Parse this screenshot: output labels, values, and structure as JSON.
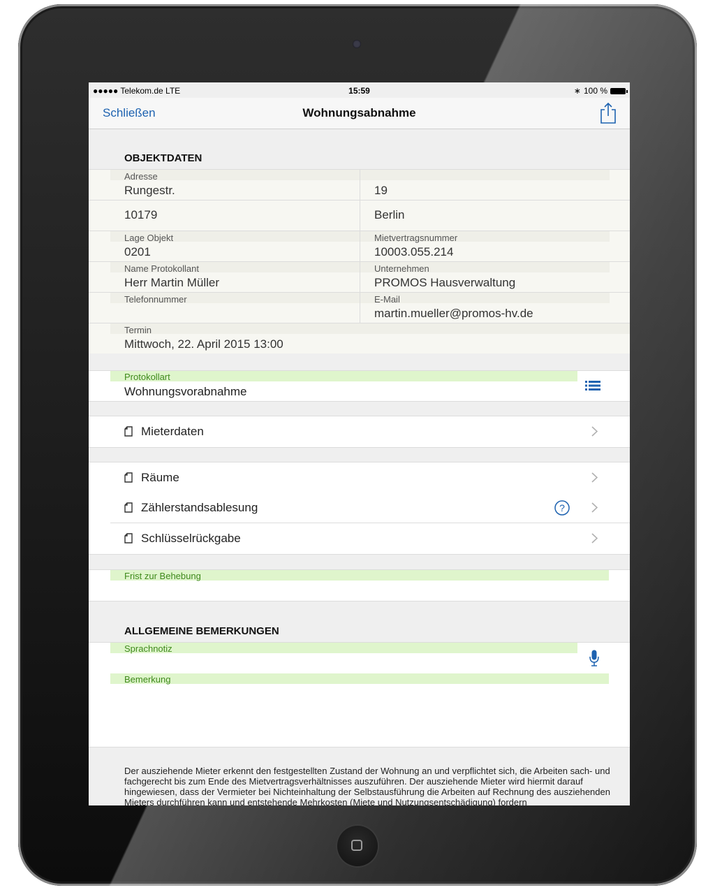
{
  "statusbar": {
    "carrier": "●●●●● Telekom.de  LTE",
    "time": "15:59",
    "battery": "100 %"
  },
  "navbar": {
    "close_label": "Schließen",
    "title": "Wohnungsabnahme"
  },
  "objektdaten": {
    "heading": "OBJEKTDATEN",
    "address_label": "Adresse",
    "street": "Rungestr.",
    "house_number": "19",
    "zip": "10179",
    "city": "Berlin",
    "lage_label": "Lage Objekt",
    "lage_value": "0201",
    "mietvertrag_label": "Mietvertragsnummer",
    "mietvertrag_value": "10003.055.214",
    "protokollant_label": "Name Protokollant",
    "protokollant_value": "Herr Martin Müller",
    "unternehmen_label": "Unternehmen",
    "unternehmen_value": "PROMOS Hausverwaltung",
    "telefon_label": "Telefonnummer",
    "telefon_value": "",
    "email_label": "E-Mail",
    "email_value": "martin.mueller@promos-hv.de",
    "termin_label": "Termin",
    "termin_value": "Mittwoch, 22. April 2015 13:00"
  },
  "protokollart": {
    "label": "Protokollart",
    "value": "Wohnungsvorabnahme"
  },
  "list1": [
    {
      "label": "Mieterdaten"
    }
  ],
  "list2": [
    {
      "label": "Räume"
    },
    {
      "label": "Zählerstandsablesung"
    },
    {
      "label": "Schlüsselrückgabe"
    }
  ],
  "frist": {
    "label": "Frist zur Behebung"
  },
  "bemerkungen": {
    "heading": "ALLGEMEINE BEMERKUNGEN",
    "sprachnotiz_label": "Sprachnotiz",
    "bemerkung_label": "Bemerkung"
  },
  "footer": {
    "text": "Der ausziehende Mieter erkennt den festgestellten Zustand der Wohnung an und verpflichtet sich, die Arbeiten sach- und fachgerecht bis zum Ende des Mietvertragsverhältnisses auszuführen. Der ausziehende Mieter wird hiermit darauf hingewiesen, dass der Vermieter bei Nichteinhaltung der Selbstausführung die Arbeiten auf Rechnung des ausziehenden Mieters durchführen kann und entstehende Mehrkosten (Miete und Nutzungsentschädigung) fordern"
  },
  "colors": {
    "accent": "#1d62b0",
    "label_green": "#3f8a1c",
    "label_band": "#dff5cc"
  }
}
